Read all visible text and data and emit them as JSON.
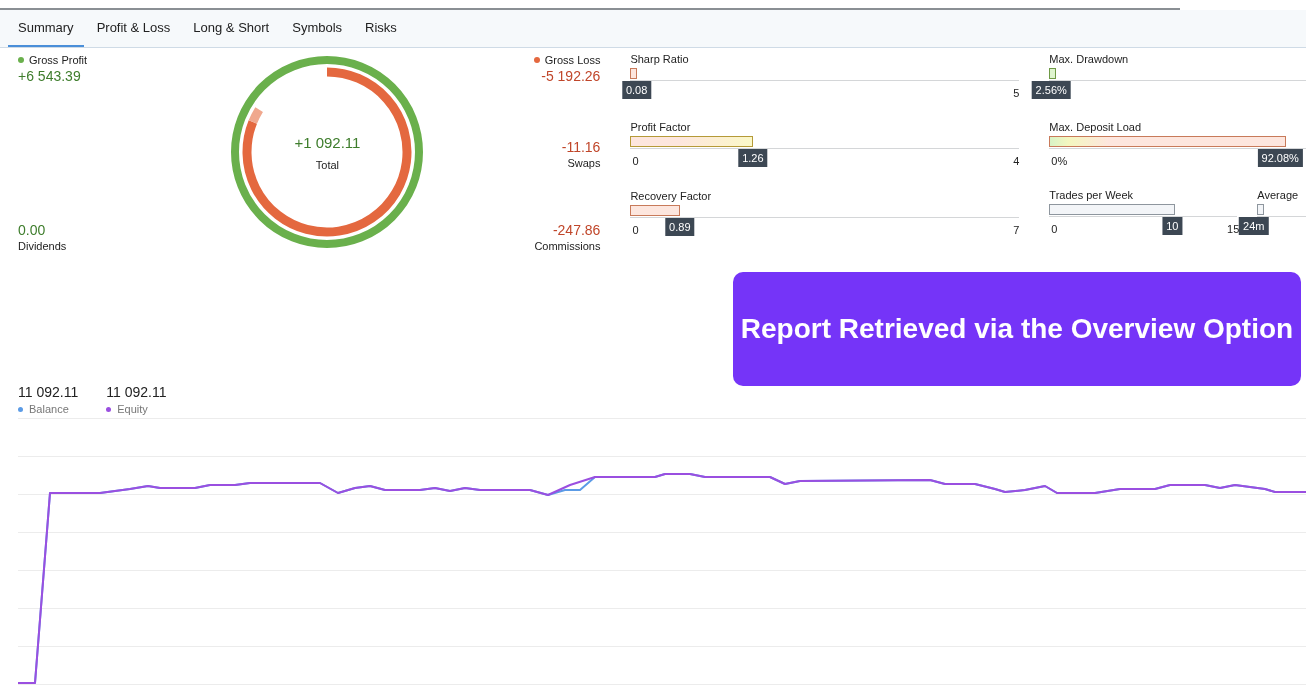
{
  "tabs": [
    {
      "label": "Summary",
      "selected": true
    },
    {
      "label": "Profit & Loss",
      "selected": false
    },
    {
      "label": "Long & Short",
      "selected": false
    },
    {
      "label": "Symbols",
      "selected": false
    },
    {
      "label": "Risks",
      "selected": false
    }
  ],
  "summary": {
    "gross_profit": {
      "label": "Gross Profit",
      "value": "+6 543.39",
      "color": "#6ab04c"
    },
    "dividends": {
      "label": "Dividends",
      "value": "0.00"
    },
    "total": {
      "label": "Total",
      "value": "+1 092.11"
    },
    "gross_loss": {
      "label": "Gross Loss",
      "value": "-5 192.26",
      "color": "#e4683f"
    },
    "swaps": {
      "label": "Swaps",
      "value": "-11.16"
    },
    "commissions": {
      "label": "Commissions",
      "value": "-247.86"
    }
  },
  "gauges_left": [
    {
      "label": "Sharp Ratio",
      "max": "5",
      "value": "0.08",
      "level": 0.016,
      "kind": "loss"
    },
    {
      "label": "Profit Factor",
      "min": "0",
      "max": "4",
      "value": "1.26",
      "level": 0.315,
      "kind": "mixed"
    },
    {
      "label": "Recovery Factor",
      "min": "0",
      "max": "7",
      "value": "0.89",
      "level": 0.127,
      "kind": "loss"
    }
  ],
  "gauges_right": [
    {
      "label": "Max. Drawdown",
      "value": "2.56%",
      "level": 0.0256,
      "kind": "gain"
    },
    {
      "label": "Max. Deposit Load",
      "min": "0%",
      "value": "92.08%",
      "level": 0.9208,
      "kind": "rising"
    },
    {
      "label": "Trades per Week",
      "min": "0",
      "max": "15",
      "value": "10",
      "level": 0.667,
      "kind": "neutral"
    },
    {
      "label": "Average",
      "value": "24m",
      "level": 0.02,
      "kind": "neutral"
    }
  ],
  "banner": {
    "text": "Report Retrieved via the Overview Option"
  },
  "balance_chart": {
    "series": [
      {
        "name": "Balance",
        "value": "11 092.11",
        "color": "#5b9be6"
      },
      {
        "name": "Equity",
        "value": "11 092.11",
        "color": "#9a4fe0"
      }
    ]
  }
}
